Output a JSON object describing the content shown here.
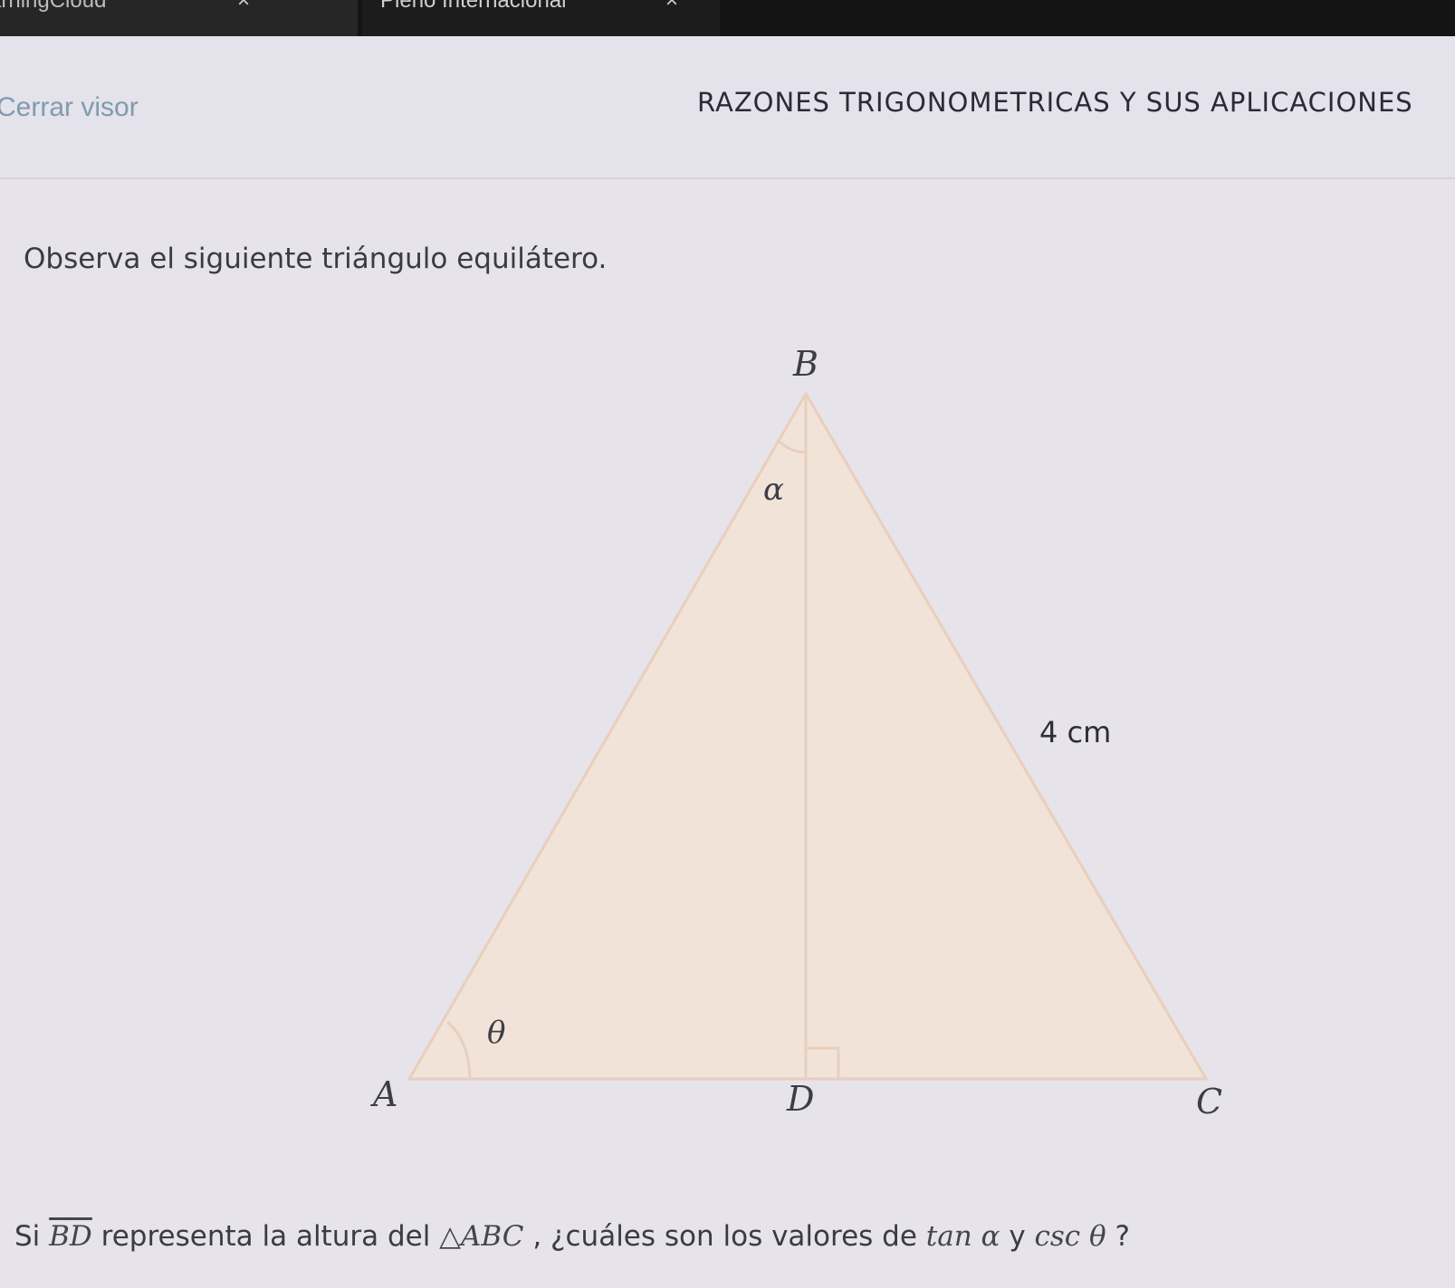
{
  "tabs": [
    {
      "label": "arningCloud",
      "close": "×"
    },
    {
      "label": "Pleno Internacional",
      "close": "×"
    }
  ],
  "viewer": {
    "close_label": "Cerrar visor",
    "title": "RAZONES TRIGONOMETRICAS Y SUS APLICACIONES"
  },
  "content": {
    "intro": "Observa el siguiente triángulo equilátero.",
    "figure": {
      "vertex_b": "B",
      "vertex_a": "A",
      "vertex_d": "D",
      "vertex_c": "C",
      "angle_alpha": "α",
      "angle_theta": "θ",
      "side_length": "4 cm",
      "fill_color": "#f1e3d8",
      "stroke_color": "#e8cfbd"
    },
    "question": {
      "prefix": "Si ",
      "segment": "BD",
      "middle": " representa la altura del ",
      "triangle": "△ABC",
      "after_triangle": ", ¿cuáles son los valores de ",
      "tan_expr": "tan α",
      "conj": " y ",
      "csc_expr": "csc θ",
      "suffix": " ?"
    }
  }
}
